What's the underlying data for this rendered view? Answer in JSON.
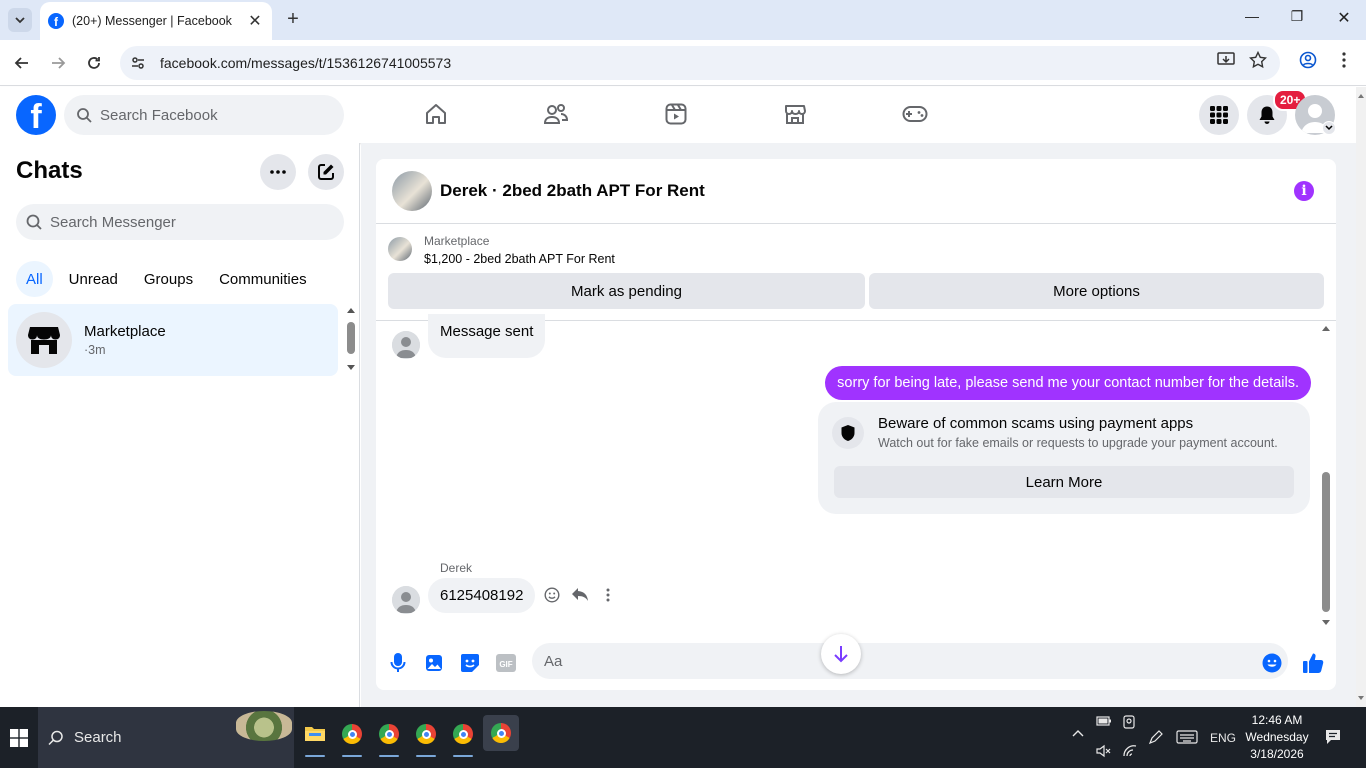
{
  "browser": {
    "tab_title": "(20+) Messenger | Facebook",
    "url": "facebook.com/messages/t/1536126741005573",
    "new_tab_symbol": "+",
    "close_symbol": "✕",
    "window_controls": {
      "minimize": "—",
      "maximize": "❐",
      "close": "✕"
    }
  },
  "fb_header": {
    "logo_letter": "f",
    "search_placeholder": "Search Facebook",
    "notification_badge": "20+",
    "nav_icons": [
      "home-icon",
      "friends-icon",
      "watch-icon",
      "marketplace-icon",
      "gaming-icon"
    ]
  },
  "sidebar": {
    "title": "Chats",
    "search_placeholder": "Search Messenger",
    "filters": [
      {
        "label": "All",
        "active": true
      },
      {
        "label": "Unread",
        "active": false
      },
      {
        "label": "Groups",
        "active": false
      },
      {
        "label": "Communities",
        "active": false
      }
    ],
    "chats": [
      {
        "name": "Marketplace",
        "time": "·3m"
      }
    ]
  },
  "conversation": {
    "header_title": "Derek · 2bed 2bath APT For Rent",
    "listing": {
      "source": "Marketplace",
      "title": "$1,200 - 2bed 2bath APT For Rent",
      "mark_pending_label": "Mark as pending",
      "more_options_label": "More options"
    },
    "messages": {
      "system_message": "Message sent",
      "outgoing": "sorry for being late, please send me your contact number for the details.",
      "warning": {
        "title": "Beware of common scams using payment apps",
        "subtitle": "Watch out for fake emails or requests to upgrade your payment account.",
        "button": "Learn More"
      },
      "incoming_sender": "Derek",
      "incoming": "6125408192"
    },
    "composer_placeholder": "Aa"
  },
  "taskbar": {
    "search_label": "Search",
    "language": "ENG",
    "time": "12:46 AM",
    "day": "Wednesday",
    "date": "3/18/2026"
  },
  "colors": {
    "fb_blue": "#0866ff",
    "messenger_purple": "#a033ff",
    "notification_red": "#e41e3f"
  }
}
